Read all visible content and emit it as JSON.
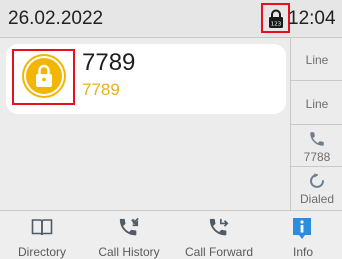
{
  "status_bar": {
    "date": "26.02.2022",
    "time": "12:04",
    "lock_badge": "123",
    "lock_icon": "padlock-icon"
  },
  "call": {
    "avatar_icon": "padlock-icon",
    "name": "7789",
    "number": "7789",
    "accent_color": "#e8b219"
  },
  "side_keys": [
    {
      "label": "Line"
    },
    {
      "label": "Line"
    },
    {
      "icon": "phone-icon",
      "label": "7788"
    },
    {
      "icon": "redial-icon",
      "label": "Dialed"
    }
  ],
  "softkeys": [
    {
      "label": "Directory",
      "icon": "book-icon"
    },
    {
      "label": "Call History",
      "icon": "call-history-icon"
    },
    {
      "label": "Call Forward",
      "icon": "call-forward-icon"
    },
    {
      "label": "Info",
      "icon": "info-icon"
    }
  ],
  "colors": {
    "highlight": "#e8101e",
    "icon": "#6d7f8f",
    "info": "#2a8de0"
  }
}
